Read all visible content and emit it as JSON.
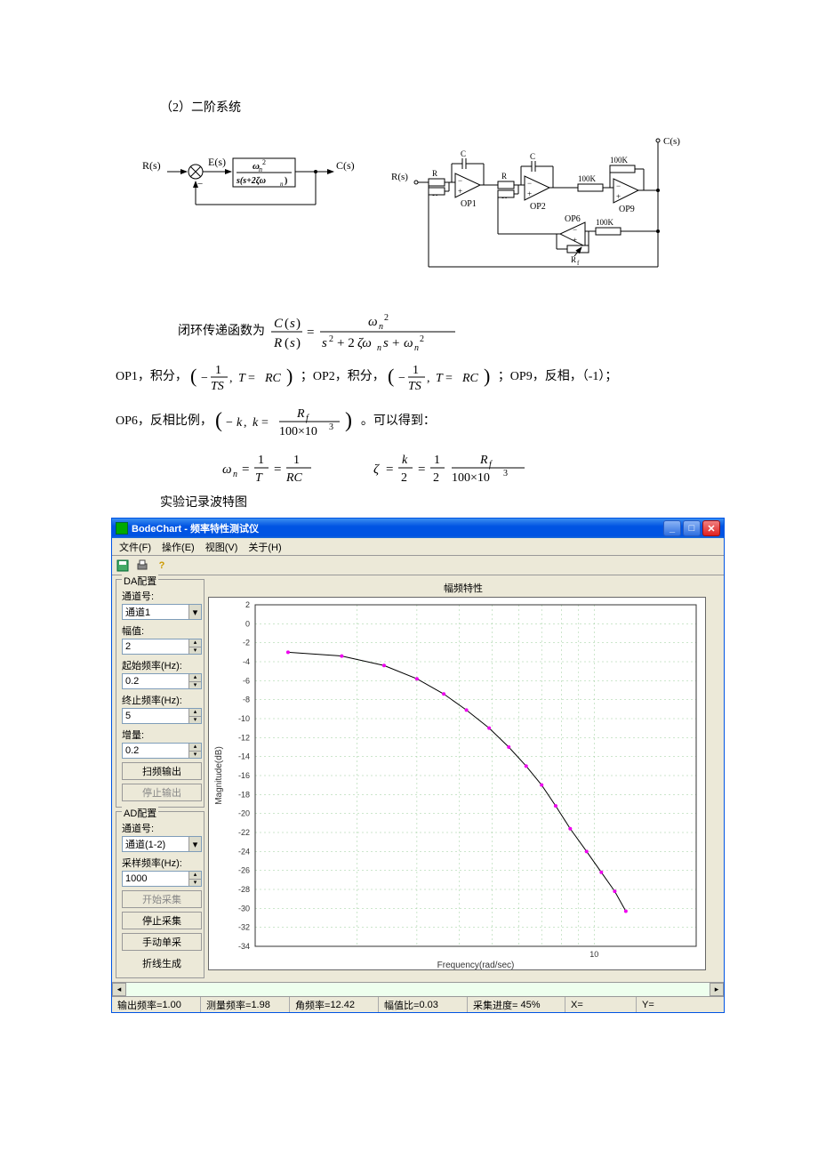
{
  "section_title": "（2）二阶系统",
  "block_diagram": {
    "R_label": "R(s)",
    "E_label": "E(s)",
    "C_label": "C(s)",
    "tf_num": "ωₙ²",
    "tf_den": "s(s+2ζωₙ)"
  },
  "circuit": {
    "R_label": "R(s)",
    "C_out_label": "C(s)",
    "R": "R",
    "C": "C",
    "OP1": "OP1",
    "OP2": "OP2",
    "OP6": "OP6",
    "OP9": "OP9",
    "val_100K": "100K",
    "Rf": "R_f"
  },
  "text": {
    "closed_loop_prefix": "闭环传递函数为",
    "op1_prefix": "OP1，积分，",
    "op2_prefix": "；OP2，积分，",
    "op9_prefix": "；OP9，反相，",
    "op9_val": "（-1）；",
    "op6_prefix": "OP6，反相比例，",
    "derive_suffix": "。可以得到：",
    "record_bode": "实验记录波特图"
  },
  "formula": {
    "closed_loop": "C(s)/R(s) = ωₙ² / (s² + 2ζωₙs + ωₙ²)",
    "int_tf": "(−1/TS , T = RC)",
    "k_def": "(−k , k = R_f / (100×10³))",
    "wn": "ωₙ = 1/T = 1/RC",
    "zeta": "ζ = k/2 = (1/2)·R_f/(100×10³)"
  },
  "app": {
    "title": "BodeChart - 频率特性测试仪",
    "menu": {
      "file": "文件(F)",
      "op": "操作(E)",
      "view": "视图(V)",
      "about": "关于(H)"
    },
    "sidebar": {
      "da_group": "DA配置",
      "ch_label": "通道号:",
      "ch_val": "通道1",
      "amp_label": "幅值:",
      "amp_val": "2",
      "fstart_label": "起始频率(Hz):",
      "fstart_val": "0.2",
      "fstop_label": "终止频率(Hz):",
      "fstop_val": "5",
      "inc_label": "增量:",
      "inc_val": "0.2",
      "btn_sweep": "扫频输出",
      "btn_stop_out": "停止输出",
      "ad_group": "AD配置",
      "ad_ch_label": "通道号:",
      "ad_ch_val": "通道(1-2)",
      "fs_label": "采样频率(Hz):",
      "fs_val": "1000",
      "btn_start_samp": "开始采集",
      "btn_stop_samp": "停止采集",
      "btn_manual": "手动单采",
      "btn_polyline": "折线生成"
    },
    "chart_title": "幅频特性",
    "chart_xlabel": "Frequency(rad/sec)",
    "chart_ylabel": "Magnitude(dB)",
    "chart_xtick_10": "10",
    "status": {
      "out_freq_label": "输出频率=",
      "out_freq_val": "1.00",
      "meas_freq_label": "测量频率=",
      "meas_freq_val": "1.98",
      "ang_freq_label": "角频率=",
      "ang_freq_val": "12.42",
      "amp_ratio_label": "幅值比=",
      "amp_ratio_val": "0.03",
      "progress_label": "采集进度=",
      "progress_val": "45%",
      "x_label": "X=",
      "y_label": "Y="
    }
  },
  "chart_data": {
    "type": "line",
    "title": "幅频特性",
    "xlabel": "Frequency(rad/sec)",
    "ylabel": "Magnitude(dB)",
    "xscale": "log",
    "xlim": [
      1,
      20
    ],
    "ylim": [
      -34,
      2
    ],
    "yticks": [
      2,
      0,
      -2,
      -4,
      -6,
      -8,
      -10,
      -12,
      -14,
      -16,
      -18,
      -20,
      -22,
      -24,
      -26,
      -28,
      -30,
      -32,
      -34
    ],
    "x": [
      1.25,
      1.8,
      2.4,
      3.0,
      3.6,
      4.2,
      4.9,
      5.6,
      6.3,
      7.0,
      7.7,
      8.5,
      9.5,
      10.5,
      11.5,
      12.4
    ],
    "y": [
      -3.0,
      -3.4,
      -4.4,
      -5.8,
      -7.4,
      -9.1,
      -11.0,
      -13.0,
      -15.0,
      -17.0,
      -19.2,
      -21.6,
      -24.0,
      -26.2,
      -28.2,
      -30.3
    ]
  }
}
